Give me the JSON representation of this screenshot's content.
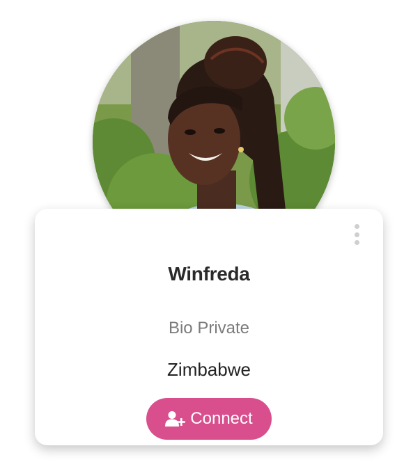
{
  "profile": {
    "name": "Winfreda",
    "bio": "Bio Private",
    "country": "Zimbabwe",
    "connect_label": "Connect",
    "photo_icon": "profile-photo",
    "menu_icon": "more-vertical-icon",
    "connect_icon": "user-plus-icon"
  },
  "colors": {
    "accent": "#d94f8d",
    "card_bg": "#ffffff",
    "name_text": "#2a2a2a",
    "bio_text": "#7b7b7b"
  }
}
